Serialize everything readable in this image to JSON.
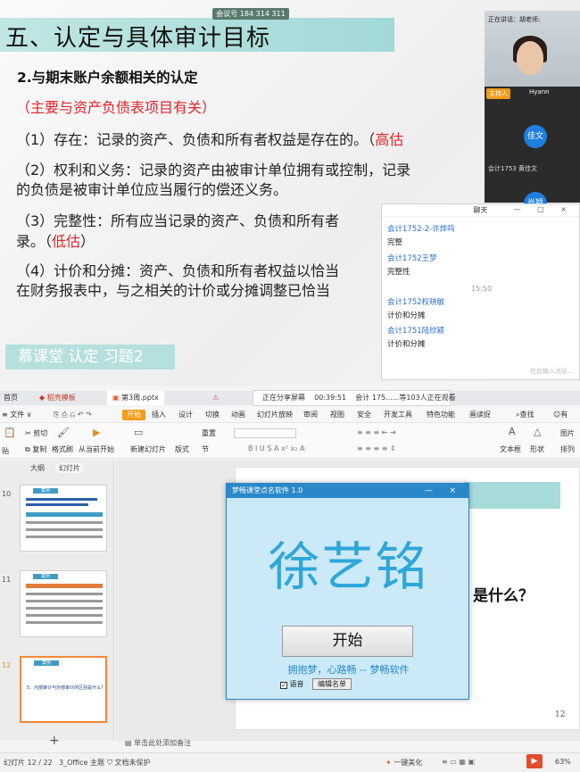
{
  "slide": {
    "title": "五、认定与具体审计目标",
    "meeting_id": "会议号 184 314 311",
    "subheading": "2.与期末账户余额相关的认定",
    "note": "（主要与资产负债表项目有关）",
    "items": [
      {
        "text": "（1）存在：记录的资产、负债和所有者权益是存在的。（",
        "risk": "高估"
      },
      {
        "text": "（2）权利和义务：记录的资产由被审计单位拥有或控制，记录",
        "text2": "的负债是被审计单位应当履行的偿还义务。"
      },
      {
        "text": "（3）完整性：所有应当记录的资产、负债和所有者",
        "text2": "录。（",
        "risk": "低估",
        "close": "）"
      },
      {
        "text": "（4）计价和分摊：资产、负债和所有者权益以恰当",
        "text2": "在财务报表中，与之相关的计价或分摊调整已恰当"
      }
    ],
    "mooc_label": "慕课堂 认定 习题2"
  },
  "cam": {
    "speaking": "正在讲话：胡老师;",
    "host_badge": "主持人",
    "host_user": "Hyann",
    "avatar1": "佳文",
    "name1": "会计1753 黄佳文",
    "avatar2": "肖颖"
  },
  "chat": {
    "title": "聊天",
    "controls": "— □ ×",
    "messages": [
      {
        "name": "会计1752-2-许烨鸣",
        "msg": "完整"
      },
      {
        "name": "会计1752王梦",
        "msg": "完整性"
      },
      {
        "name": "会计1752权晓敏",
        "msg": "计价和分摊"
      },
      {
        "name": "会计1751陆欣颖",
        "msg": "计价和分摊"
      }
    ],
    "time": "15:50",
    "input_hint": "在此输入消息…"
  },
  "share_bar": {
    "status": "正在分享屏幕",
    "timer": "00:39:51",
    "viewers": "会计 175......等103人正在观看"
  },
  "wps": {
    "tabs": [
      "首页",
      "稻壳模板",
      "第3周.pptx"
    ],
    "menu": [
      "≡ 文件 ∨",
      "开始",
      "插入",
      "设计",
      "切换",
      "动画",
      "幻灯片放映",
      "审阅",
      "视图",
      "安全",
      "开发工具",
      "特色功能",
      "画读捉"
    ],
    "search": "查找",
    "rights": "有",
    "ribbon": {
      "paste": "贴",
      "cut": "剪切",
      "copy": "复制",
      "format": "格式刷",
      "from_start": "从当前开始",
      "new_slide": "新建幻灯片",
      "layout": "版式",
      "section": "节",
      "reset": "重置",
      "textbox": "文本框",
      "shape": "形状",
      "arrange": "排列",
      "image": "图片"
    },
    "thumb_tabs": [
      "大纲",
      "幻灯片"
    ],
    "thumb_nums": [
      "10",
      "11",
      "12"
    ],
    "thumb_head": "案例",
    "thumb12_text": "5、内部审计与外部审计的区别是什么？",
    "slide_question": "是什么？",
    "slide_num": "12",
    "notes": "单击此处添加备注",
    "status": {
      "slide_pos": "幻灯片 12 / 22",
      "theme": "3_Office 主题",
      "protect": "文档未保护",
      "beautify": "一键美化",
      "zoom": "63%"
    }
  },
  "dialog": {
    "title": "梦畅课堂点名软件 1.0",
    "controls": "— ×",
    "name": "徐艺铭",
    "start": "开始",
    "slogan": "拥抱梦，心路畅 -- 梦畅软件",
    "voice": "语音",
    "voice_checked": "✓",
    "edit": "编辑名单"
  }
}
